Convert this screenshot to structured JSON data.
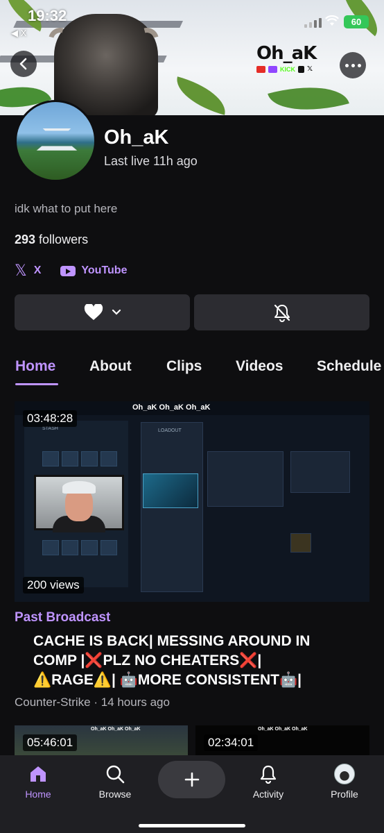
{
  "status": {
    "time": "19:32",
    "back_app": "◀ X",
    "battery": "60"
  },
  "banner": {
    "logo_text": "Oh_aK",
    "logo_kick": "KICK"
  },
  "profile": {
    "name": "Oh_aK",
    "last_live": "Last live 11h ago",
    "bio": "idk what to put here",
    "followers_count": "293",
    "followers_label": " followers"
  },
  "links": [
    {
      "icon": "x-icon",
      "label": "X"
    },
    {
      "icon": "youtube-icon",
      "label": "YouTube"
    }
  ],
  "tabs": [
    "Home",
    "About",
    "Clips",
    "Videos",
    "Schedule"
  ],
  "active_tab": "Home",
  "featured": {
    "duration": "03:48:28",
    "views": "200 views",
    "kind": "Past Broadcast",
    "title_line1": "CACHE IS BACK| MESSING AROUND IN",
    "title_line2": "COMP |❌PLZ NO CHEATERS❌|",
    "title_line3": "⚠️RAGE⚠️| 🤖MORE CONSISTENT🤖|",
    "category": "Counter-Strike",
    "age": "14 hours ago",
    "meta": "Counter-Strike · 14 hours ago",
    "thumb_bar": "Oh_aK  Oh_aK  Oh_aK",
    "loadout_label": "LOADOUT",
    "stash_label": "STASH"
  },
  "more_videos": [
    {
      "duration": "05:46:01",
      "bar": "Oh_aK Oh_aK Oh_aK"
    },
    {
      "duration": "02:34:01",
      "bar": "Oh_aK Oh_aK Oh_aK"
    }
  ],
  "nav": {
    "home": "Home",
    "browse": "Browse",
    "activity": "Activity",
    "profile": "Profile"
  },
  "colors": {
    "accent": "#bf94ff",
    "background": "#0e0e10",
    "button": "#2c2c31",
    "nav": "#1f1f23"
  }
}
